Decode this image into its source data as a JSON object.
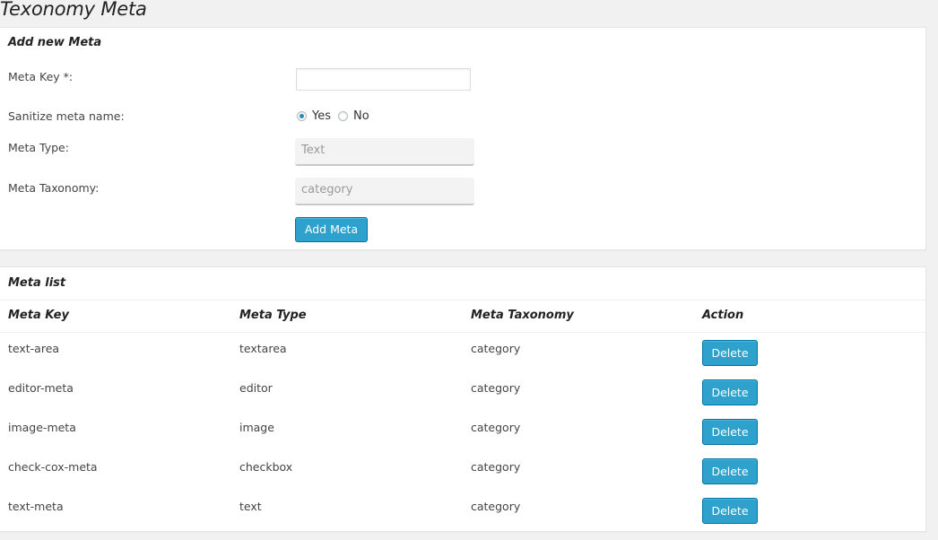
{
  "page": {
    "title": "Texonomy Meta"
  },
  "add_panel": {
    "title": "Add new Meta",
    "meta_key_label": "Meta Key *:",
    "meta_key_value": "",
    "sanitize_label": "Sanitize meta name:",
    "sanitize_options": [
      "Yes",
      "No"
    ],
    "sanitize_selected": "Yes",
    "meta_type_label": "Meta Type:",
    "meta_type_value": "Text",
    "meta_taxonomy_label": "Meta Taxonomy:",
    "meta_taxonomy_value": "category",
    "add_button": "Add Meta"
  },
  "list_panel": {
    "title": "Meta list",
    "columns": [
      "Meta Key",
      "Meta Type",
      "Meta Taxonomy",
      "Action"
    ],
    "rows": [
      {
        "key": "text-area",
        "type": "textarea",
        "taxonomy": "category",
        "action": "Delete"
      },
      {
        "key": "editor-meta",
        "type": "editor",
        "taxonomy": "category",
        "action": "Delete"
      },
      {
        "key": "image-meta",
        "type": "image",
        "taxonomy": "category",
        "action": "Delete"
      },
      {
        "key": "check-cox-meta",
        "type": "checkbox",
        "taxonomy": "category",
        "action": "Delete"
      },
      {
        "key": "text-meta",
        "type": "text",
        "taxonomy": "category",
        "action": "Delete"
      }
    ]
  },
  "colors": {
    "primary_button": "#2ea2cc",
    "primary_button_border": "#0074a2",
    "radio_checked": "#1e8cbe"
  }
}
